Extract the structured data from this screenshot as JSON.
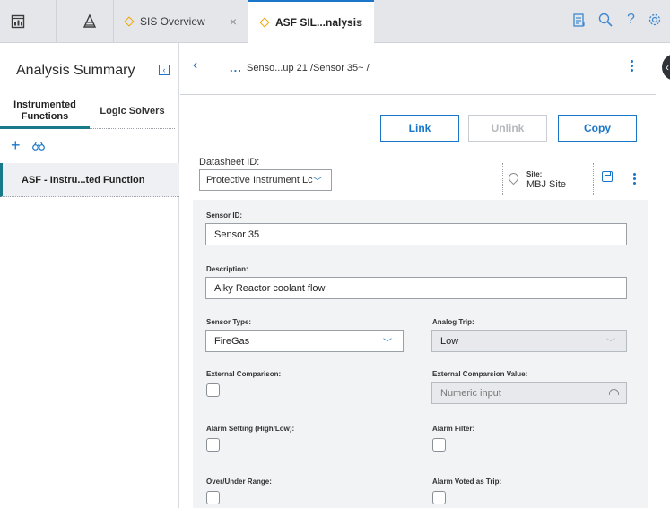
{
  "topbar": {
    "tabs": [
      {
        "label": "SIS Overview",
        "active": false
      },
      {
        "label": "ASF SIL...nalysis",
        "active": true
      }
    ],
    "close_glyph": "×",
    "icons": [
      "dashboard-icon",
      "apm-logo-icon",
      "clipboard-icon",
      "search-icon",
      "help-icon",
      "gear-icon"
    ]
  },
  "left_panel": {
    "title": "Analysis Summary",
    "tabs": [
      "Instrumented Functions",
      "Logic Solvers"
    ],
    "list": [
      {
        "label": "ASF - Instru...ted Function"
      }
    ]
  },
  "main": {
    "breadcrumb": {
      "dots": "...",
      "text": "Senso...up 21 /Sensor 35~ /"
    },
    "buttons": {
      "link": "Link",
      "unlink": "Unlink",
      "copy": "Copy"
    },
    "datasheet": {
      "label": "Datasheet ID:",
      "value": "Protective Instrument Lc"
    },
    "site": {
      "label": "Site:",
      "value": "MBJ Site"
    },
    "form": {
      "sensor_id": {
        "label": "Sensor ID:",
        "value": "Sensor 35"
      },
      "description": {
        "label": "Description:",
        "value": "Alky Reactor coolant flow"
      },
      "sensor_type": {
        "label": "Sensor Type:",
        "value": "FireGas"
      },
      "analog_trip": {
        "label": "Analog Trip:",
        "value": "Low"
      },
      "external_comparison": {
        "label": "External Comparison:",
        "checked": false
      },
      "external_comparison_value": {
        "label": "External Comparsion Value:",
        "placeholder": "Numeric input"
      },
      "alarm_setting": {
        "label": "Alarm Setting (High/Low):",
        "checked": false
      },
      "alarm_filter": {
        "label": "Alarm Filter:",
        "checked": false
      },
      "over_under_range": {
        "label": "Over/Under Range:",
        "checked": false
      },
      "alarm_voted_as_trip": {
        "label": "Alarm Voted as Trip:",
        "checked": false
      }
    }
  },
  "colors": {
    "accent": "#1976c8",
    "teal": "#1a7a8a",
    "warning": "#f2a400"
  }
}
